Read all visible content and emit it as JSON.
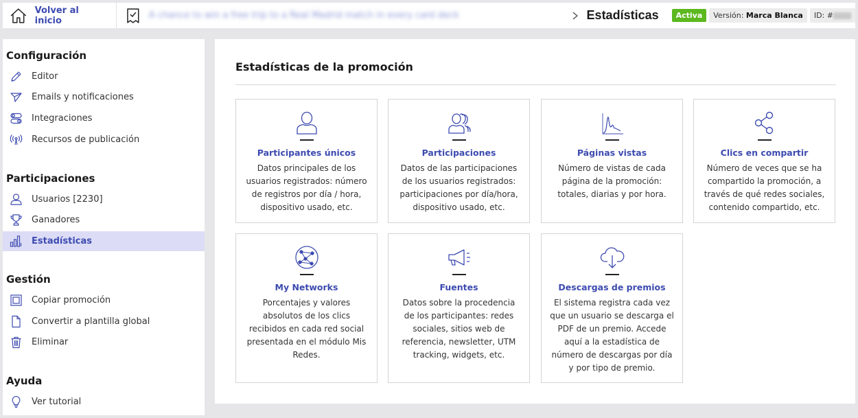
{
  "header": {
    "home_label": "Volver al inicio",
    "promo_name": "A chance to win a free trip to a Real Madrid match in every card deck",
    "page_title": "Estadísticas",
    "status_badge": "Activa",
    "version_label": "Versión:",
    "version_value": "Marca Blanca",
    "id_label": "ID: #"
  },
  "sidebar": {
    "sections": [
      {
        "title": "Configuración"
      },
      {
        "title": "Participaciones"
      },
      {
        "title": "Gestión"
      },
      {
        "title": "Ayuda"
      }
    ],
    "items": [
      {
        "label": "Editor",
        "icon": "pencil-icon"
      },
      {
        "label": "Emails y notificaciones",
        "icon": "paper-plane-icon"
      },
      {
        "label": "Integraciones",
        "icon": "toggles-icon"
      },
      {
        "label": "Recursos de publicación",
        "icon": "broadcast-icon"
      },
      {
        "label": "Usuarios [2230]",
        "icon": "user-icon"
      },
      {
        "label": "Ganadores",
        "icon": "trophy-icon"
      },
      {
        "label": "Estadísticas",
        "icon": "bar-chart-icon",
        "active": true
      },
      {
        "label": "Copiar promoción",
        "icon": "copy-icon"
      },
      {
        "label": "Convertir a plantilla global",
        "icon": "document-icon"
      },
      {
        "label": "Eliminar",
        "icon": "trash-icon"
      },
      {
        "label": "Ver tutorial",
        "icon": "lightbulb-icon"
      }
    ]
  },
  "main": {
    "title": "Estadísticas de la promoción",
    "cards": [
      {
        "title": "Participantes únicos",
        "icon": "user-icon",
        "description": "Datos principales de los usuarios registrados: número de registros por día / hora, dispositivo usado, etc."
      },
      {
        "title": "Participaciones",
        "icon": "users-group-icon",
        "description": "Datos de las participaciones de los usuarios registrados: participaciones por día/hora, dispositivo usado, etc."
      },
      {
        "title": "Páginas vistas",
        "icon": "line-spike-icon",
        "description": "Número de vistas de cada página de la promoción: totales, diarias y por hora."
      },
      {
        "title": "Clics en compartir",
        "icon": "share-icon",
        "description": "Número de veces que se ha compartido la promoción, a través de qué redes sociales, contenido compartido, etc."
      },
      {
        "title": "My Networks",
        "icon": "network-globe-icon",
        "description": "Porcentajes y valores absolutos de los clics recibidos en cada red social presentada en el módulo Mis Redes."
      },
      {
        "title": "Fuentes",
        "icon": "megaphone-icon",
        "description": "Datos sobre la procedencia de los participantes: redes sociales, sitios web de referencia, newsletter, UTM tracking, widgets, etc."
      },
      {
        "title": "Descargas de premios",
        "icon": "cloud-download-icon",
        "description": "El sistema registra cada vez que un usuario se descarga el PDF de un premio. Accede aquí a la estadística de número de descargas por día y por tipo de premio."
      }
    ]
  }
}
